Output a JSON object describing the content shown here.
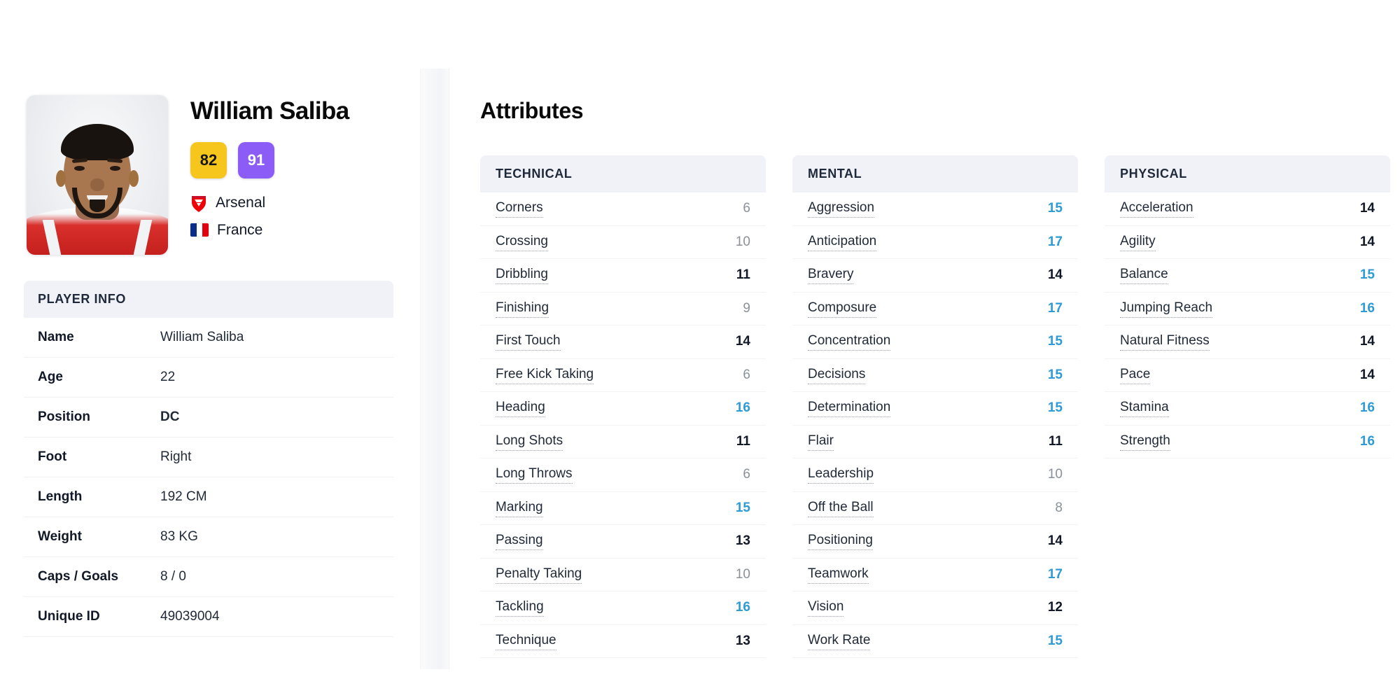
{
  "player": {
    "name": "William Saliba",
    "current_ability_badge": "82",
    "potential_ability_badge": "91",
    "club": "Arsenal",
    "nation": "France",
    "club_icon": "arsenal-crest-icon",
    "nation_icon": "france-flag-icon",
    "portrait_alt": "William Saliba portrait"
  },
  "badge_colors": {
    "current": "#F6C61C",
    "potential": "#8B5CF6"
  },
  "value_colors": {
    "low": "#8b9199",
    "mid": "#111827",
    "high": "#2e9ad6"
  },
  "player_info": {
    "header": "PLAYER INFO",
    "rows": [
      {
        "label": "Name",
        "value": "William Saliba",
        "emphasis": false
      },
      {
        "label": "Age",
        "value": "22",
        "emphasis": false
      },
      {
        "label": "Position",
        "value": "DC",
        "emphasis": true
      },
      {
        "label": "Foot",
        "value": "Right",
        "emphasis": false
      },
      {
        "label": "Length",
        "value": "192 CM",
        "emphasis": false
      },
      {
        "label": "Weight",
        "value": "83 KG",
        "emphasis": false
      },
      {
        "label": "Caps / Goals",
        "value": "8 / 0",
        "emphasis": false
      },
      {
        "label": "Unique ID",
        "value": "49039004",
        "emphasis": false
      }
    ]
  },
  "attributes": {
    "title": "Attributes",
    "columns": [
      {
        "header": "TECHNICAL",
        "rows": [
          {
            "name": "Corners",
            "value": 6
          },
          {
            "name": "Crossing",
            "value": 10
          },
          {
            "name": "Dribbling",
            "value": 11
          },
          {
            "name": "Finishing",
            "value": 9
          },
          {
            "name": "First Touch",
            "value": 14
          },
          {
            "name": "Free Kick Taking",
            "value": 6
          },
          {
            "name": "Heading",
            "value": 16
          },
          {
            "name": "Long Shots",
            "value": 11
          },
          {
            "name": "Long Throws",
            "value": 6
          },
          {
            "name": "Marking",
            "value": 15
          },
          {
            "name": "Passing",
            "value": 13
          },
          {
            "name": "Penalty Taking",
            "value": 10
          },
          {
            "name": "Tackling",
            "value": 16
          },
          {
            "name": "Technique",
            "value": 13
          }
        ]
      },
      {
        "header": "MENTAL",
        "rows": [
          {
            "name": "Aggression",
            "value": 15
          },
          {
            "name": "Anticipation",
            "value": 17
          },
          {
            "name": "Bravery",
            "value": 14
          },
          {
            "name": "Composure",
            "value": 17
          },
          {
            "name": "Concentration",
            "value": 15
          },
          {
            "name": "Decisions",
            "value": 15
          },
          {
            "name": "Determination",
            "value": 15
          },
          {
            "name": "Flair",
            "value": 11
          },
          {
            "name": "Leadership",
            "value": 10
          },
          {
            "name": "Off the Ball",
            "value": 8
          },
          {
            "name": "Positioning",
            "value": 14
          },
          {
            "name": "Teamwork",
            "value": 17
          },
          {
            "name": "Vision",
            "value": 12
          },
          {
            "name": "Work Rate",
            "value": 15
          }
        ]
      },
      {
        "header": "PHYSICAL",
        "rows": [
          {
            "name": "Acceleration",
            "value": 14
          },
          {
            "name": "Agility",
            "value": 14
          },
          {
            "name": "Balance",
            "value": 15
          },
          {
            "name": "Jumping Reach",
            "value": 16
          },
          {
            "name": "Natural Fitness",
            "value": 14
          },
          {
            "name": "Pace",
            "value": 14
          },
          {
            "name": "Stamina",
            "value": 16
          },
          {
            "name": "Strength",
            "value": 16
          }
        ]
      }
    ]
  }
}
